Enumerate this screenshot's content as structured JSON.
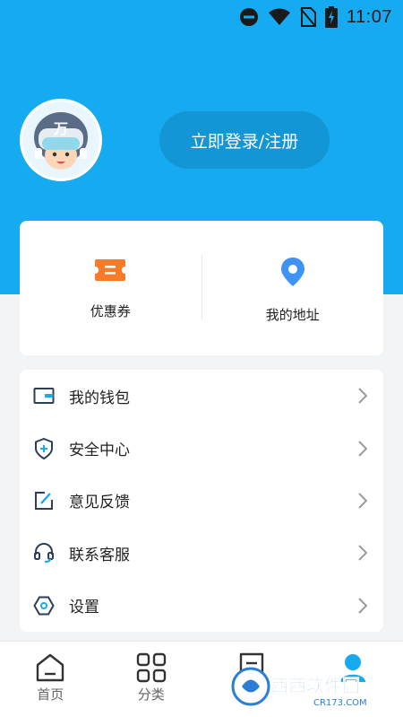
{
  "status_bar": {
    "time": "11:07"
  },
  "header": {
    "login_label": "立即登录/注册",
    "avatar_badge": "万"
  },
  "quick": [
    {
      "label": "优惠券",
      "icon": "coupon-icon"
    },
    {
      "label": "我的地址",
      "icon": "location-pin-icon"
    }
  ],
  "menu": [
    {
      "label": "我的钱包",
      "icon": "wallet-icon"
    },
    {
      "label": "安全中心",
      "icon": "shield-icon"
    },
    {
      "label": "意见反馈",
      "icon": "edit-icon"
    },
    {
      "label": "联系客服",
      "icon": "headset-icon"
    },
    {
      "label": "设置",
      "icon": "settings-icon"
    }
  ],
  "tabs": [
    {
      "label": "首页",
      "icon": "home-icon"
    },
    {
      "label": "分类",
      "icon": "grid-icon"
    },
    {
      "label": "",
      "icon": "list-icon"
    },
    {
      "label": "",
      "icon": "profile-icon"
    }
  ],
  "watermark": {
    "text": "西西软件园",
    "sub": "CR173.COM"
  },
  "colors": {
    "accent": "#16aaf0",
    "button": "#1396d6",
    "coupon": "#f77b2b"
  }
}
